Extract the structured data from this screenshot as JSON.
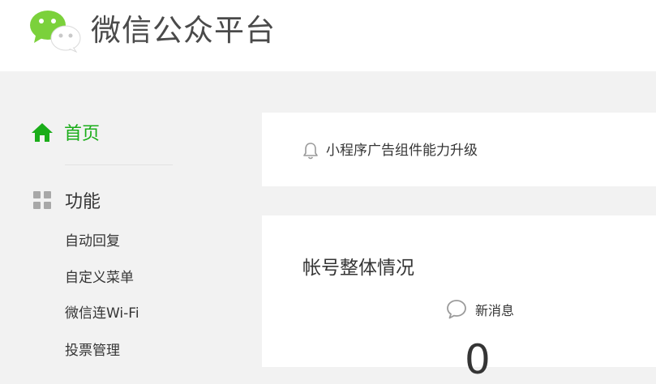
{
  "header": {
    "logo_icon": "wechat-logo",
    "title": "微信公众平台"
  },
  "colors": {
    "accent": "#1aad19",
    "text": "#353535",
    "icon_gray": "#a8a8a8",
    "background": "#f2f2f2"
  },
  "sidebar": {
    "home": {
      "icon": "home-icon",
      "label": "首页"
    },
    "functions": {
      "icon": "grid-icon",
      "label": "功能",
      "items": [
        {
          "label": "自动回复"
        },
        {
          "label": "自定义菜单"
        },
        {
          "label": "微信连Wi-Fi"
        },
        {
          "label": "投票管理"
        }
      ]
    }
  },
  "notice": {
    "icon": "bell-icon",
    "text": "小程序广告组件能力升级"
  },
  "overview": {
    "title": "帐号整体情况",
    "new_messages": {
      "icon": "chat-bubble-icon",
      "label": "新消息",
      "value": "0"
    }
  }
}
